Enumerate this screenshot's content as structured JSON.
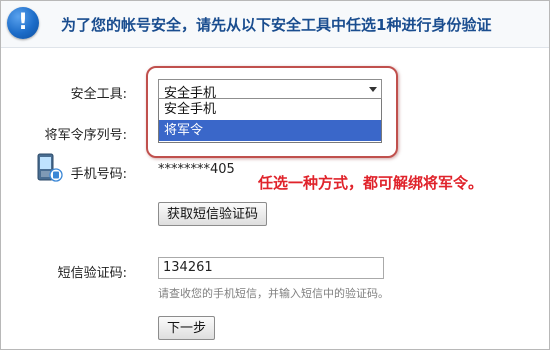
{
  "header": {
    "icon": "info-icon",
    "icon_glyph": "!",
    "title": "为了您的帐号安全，请先从以下安全工具中任选1种进行身份验证"
  },
  "form": {
    "security_tool_label": "安全工具:",
    "security_tool_value": "安全手机",
    "dropdown_options": [
      {
        "label": "安全手机",
        "selected": false
      },
      {
        "label": "将军令",
        "selected": true
      }
    ],
    "token_serial_label": "将军令序列号:",
    "phone_icon": "mobile-phone-icon",
    "phone_label": "手机号码:",
    "phone_value": "********405",
    "get_code_button": "获取短信验证码",
    "sms_code_label": "短信验证码:",
    "sms_code_value": "134261",
    "sms_hint": "请查收您的手机短信，并输入短信中的验证码。",
    "next_button": "下一步"
  },
  "annotation": {
    "text": "任选一种方式，都可解绑将军令。",
    "color": "#e0232b"
  },
  "colors": {
    "title": "#1a4d8f",
    "selected_option": "#3a67c9",
    "highlight_border": "#c0504d"
  }
}
